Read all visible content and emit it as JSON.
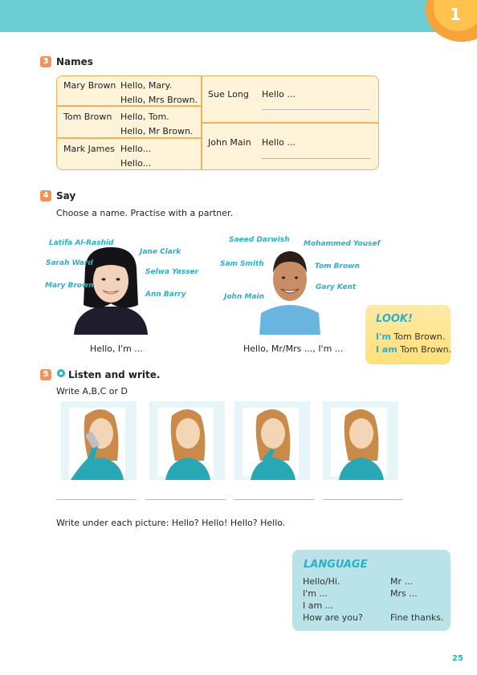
{
  "unit_number": "1",
  "exercise3": {
    "number": "3",
    "title": "Names",
    "left_rows": [
      {
        "name": "Mary Brown",
        "lines": [
          "Hello, Mary.",
          "Hello, Mrs Brown."
        ]
      },
      {
        "name": "Tom Brown",
        "lines": [
          "Hello, Tom.",
          "Hello, Mr Brown."
        ]
      },
      {
        "name": "Mark James",
        "lines": [
          "Hello...",
          "Hello..."
        ]
      }
    ],
    "right_rows": [
      {
        "name": "Sue Long",
        "line": "Hello ..."
      },
      {
        "name": "John Main",
        "line": "Hello ..."
      }
    ]
  },
  "exercise4": {
    "number": "4",
    "title": "Say",
    "instruction": "Choose a name. Practise with a partner.",
    "girl_names": [
      "Latifa Al-Rashid",
      "Jane Clark",
      "Sarah Ward",
      "Selwa Yasser",
      "Mary Brown",
      "Ann Barry"
    ],
    "boy_names": [
      "Saeed Darwish",
      "Mohammed Yousef",
      "Sam Smith",
      "Tom Brown",
      "Gary Kent",
      "John Main"
    ],
    "girl_caption": "Hello, I'm ...",
    "boy_caption": "Hello, Mr/Mrs ..., I'm ..."
  },
  "look": {
    "title": "LOOK!",
    "line1_highlight": "I'm",
    "line1_rest": " Tom Brown.",
    "line2_highlight": "I am",
    "line2_rest": " Tom Brown."
  },
  "exercise5": {
    "number": "5",
    "title": "Listen and write.",
    "instruction": "Write A,B,C or D",
    "footer_instruction": "Write under each picture: Hello? Hello! Hello? Hello."
  },
  "language": {
    "title": "LANGUAGE",
    "left": [
      "Hello/Hi.",
      "I'm ...",
      "I am ...",
      "How are you?"
    ],
    "right": [
      "Mr ...",
      "Mrs ...",
      "",
      "Fine thanks."
    ]
  },
  "page_number": "25",
  "colors": {
    "band": "#6ccdd5",
    "accent_cyan": "#2ab0c8",
    "exercise_orange": "#f2935a",
    "names_fill": "#fff3d9",
    "names_border": "#f0b25a",
    "look_fill": "#ffe07a",
    "language_fill": "#b9e3e8"
  }
}
